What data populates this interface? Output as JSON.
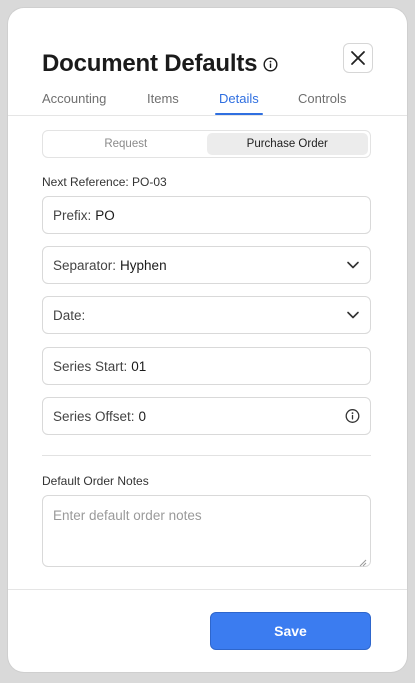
{
  "header": {
    "title": "Document Defaults",
    "info_icon": "info-icon",
    "close_icon": "close-icon"
  },
  "tabs": [
    {
      "label": "Accounting",
      "active": false
    },
    {
      "label": "Items",
      "active": false
    },
    {
      "label": "Details",
      "active": true
    },
    {
      "label": "Controls",
      "active": false
    }
  ],
  "segmented": {
    "options": [
      "Request",
      "Purchase Order"
    ],
    "selected": "Purchase Order"
  },
  "next_reference": "Next Reference: PO-03",
  "fields": {
    "prefix": {
      "label": "Prefix:",
      "value": "PO"
    },
    "separator": {
      "label": "Separator:",
      "value": "Hyphen",
      "icon": "chevron-down-icon"
    },
    "date": {
      "label": "Date:",
      "value": "",
      "icon": "chevron-down-icon"
    },
    "series_start": {
      "label": "Series Start:",
      "value": "01"
    },
    "series_offset": {
      "label": "Series Offset:",
      "value": "0",
      "icon": "info-icon"
    }
  },
  "notes": {
    "label": "Default Order Notes",
    "placeholder": "Enter default order notes"
  },
  "footer": {
    "save_label": "Save"
  },
  "colors": {
    "accent": "#2f6fe0",
    "primary_button": "#3b7cf0"
  }
}
